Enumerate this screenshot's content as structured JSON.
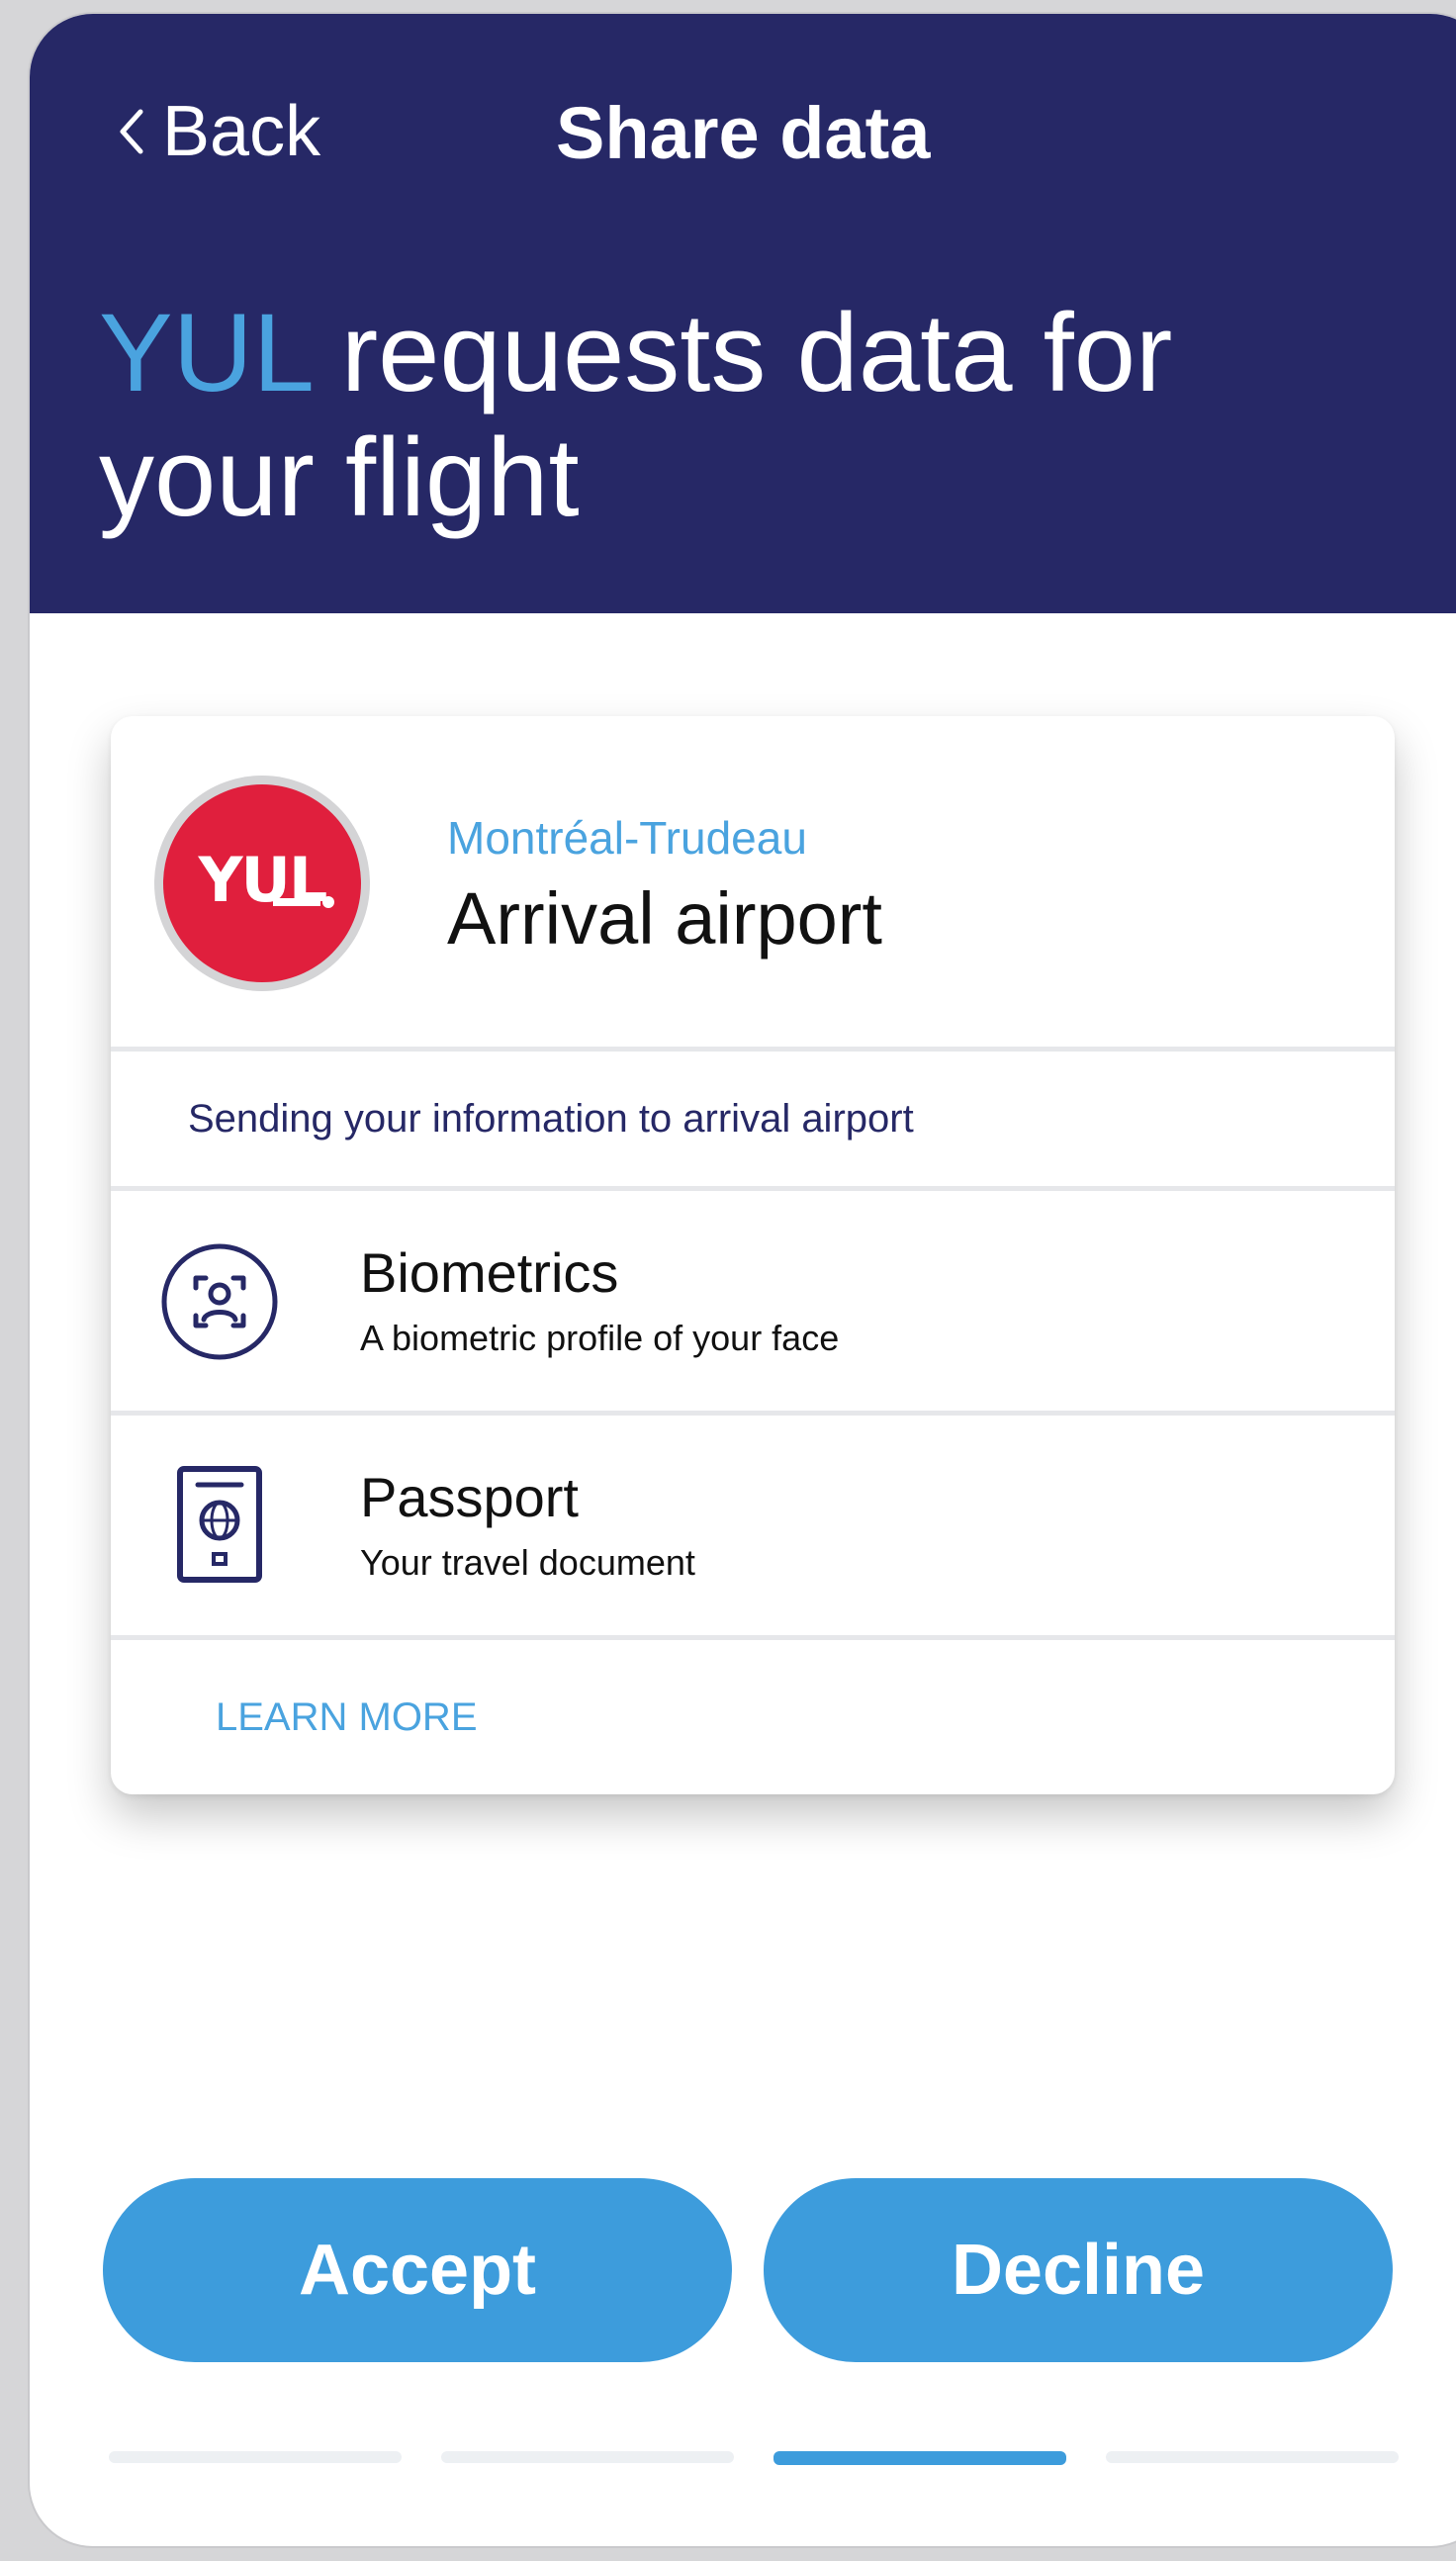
{
  "nav": {
    "back_label": "Back",
    "title": "Share data"
  },
  "headline": {
    "accent": "YUL",
    "rest": " requests data for your flight"
  },
  "airport": {
    "logo_text": "YUL",
    "name": "Montréal-Trudeau",
    "role": "Arrival airport"
  },
  "info_text": "Sending your information to arrival airport",
  "items": [
    {
      "icon": "face-scan-icon",
      "title": "Biometrics",
      "subtitle": "A biometric profile of your face"
    },
    {
      "icon": "passport-icon",
      "title": "Passport",
      "subtitle": "Your travel document"
    }
  ],
  "learn_more": "LEARN MORE",
  "actions": {
    "accept": "Accept",
    "decline": "Decline"
  },
  "pagination": {
    "total": 4,
    "active": 3
  },
  "colors": {
    "header_bg": "#262866",
    "accent": "#4aa3df",
    "button": "#3d9cdc",
    "logo_red": "#e01f3d"
  }
}
